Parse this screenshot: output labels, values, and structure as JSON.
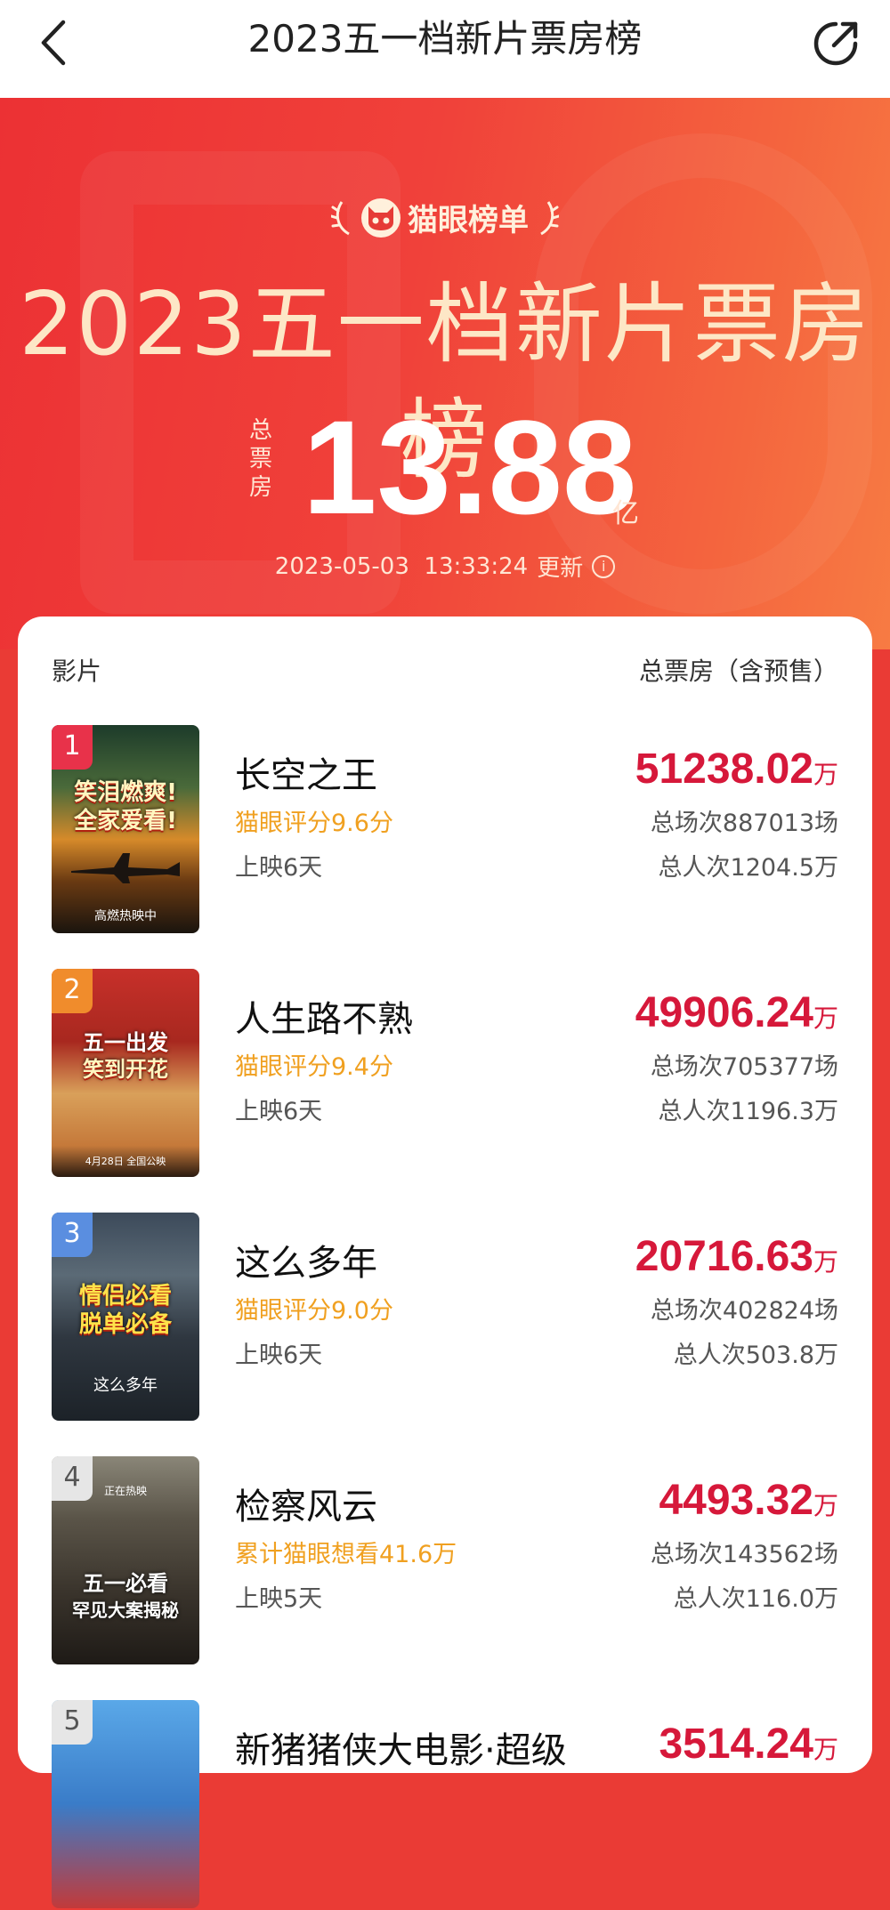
{
  "nav": {
    "title": "2023五一档新片票房榜",
    "back_icon": "chevron-left-icon",
    "share_icon": "share-icon"
  },
  "hero": {
    "brand": "猫眼榜单",
    "title": "2023五一档新片票房榜",
    "total_label": [
      "总",
      "票",
      "房"
    ],
    "total_value": "13.88",
    "total_unit": "亿",
    "update_time": "2023-05-03  13:33:24",
    "update_label": "更新"
  },
  "table": {
    "col_film": "影片",
    "col_gross": "总票房（含预售）"
  },
  "colors": {
    "accent_red": "#d6183a",
    "score_orange": "#f0a020",
    "rank1": "#e8324a",
    "rank2": "#f08c2c",
    "rank3": "#5a8ee0",
    "rank4": "#8a8a8a"
  },
  "movies": [
    {
      "rank": "1",
      "name": "长空之王",
      "score": "猫眼评分9.6分",
      "days": "上映6天",
      "gross": "51238.02",
      "gross_unit": "万",
      "sessions": "总场次887013场",
      "people": "总人次1204.5万",
      "poster_slogan_1": "笑泪燃爽!",
      "poster_slogan_2": "全家爱看!",
      "poster_tagline": "高燃热映中"
    },
    {
      "rank": "2",
      "name": "人生路不熟",
      "score": "猫眼评分9.4分",
      "days": "上映6天",
      "gross": "49906.24",
      "gross_unit": "万",
      "sessions": "总场次705377场",
      "people": "总人次1196.3万",
      "poster_slogan_1": "五一出发",
      "poster_slogan_2": "笑到开花",
      "poster_tagline": "4月28日 全国公映"
    },
    {
      "rank": "3",
      "name": "这么多年",
      "score": "猫眼评分9.0分",
      "days": "上映6天",
      "gross": "20716.63",
      "gross_unit": "万",
      "sessions": "总场次402824场",
      "people": "总人次503.8万",
      "poster_slogan_1": "情侣必看",
      "poster_slogan_2": "脱单必备",
      "poster_tagline": "这么多年"
    },
    {
      "rank": "4",
      "name": "检察风云",
      "score": "累计猫眼想看41.6万",
      "days": "上映5天",
      "gross": "4493.32",
      "gross_unit": "万",
      "sessions": "总场次143562场",
      "people": "总人次116.0万",
      "poster_slogan_1": "五一必看",
      "poster_slogan_2": "罕见大案揭秘",
      "poster_tagline": "正在热映"
    },
    {
      "rank": "5",
      "name": "新猪猪侠大电影·超级",
      "gross": "3514.24",
      "gross_unit": "万"
    }
  ]
}
